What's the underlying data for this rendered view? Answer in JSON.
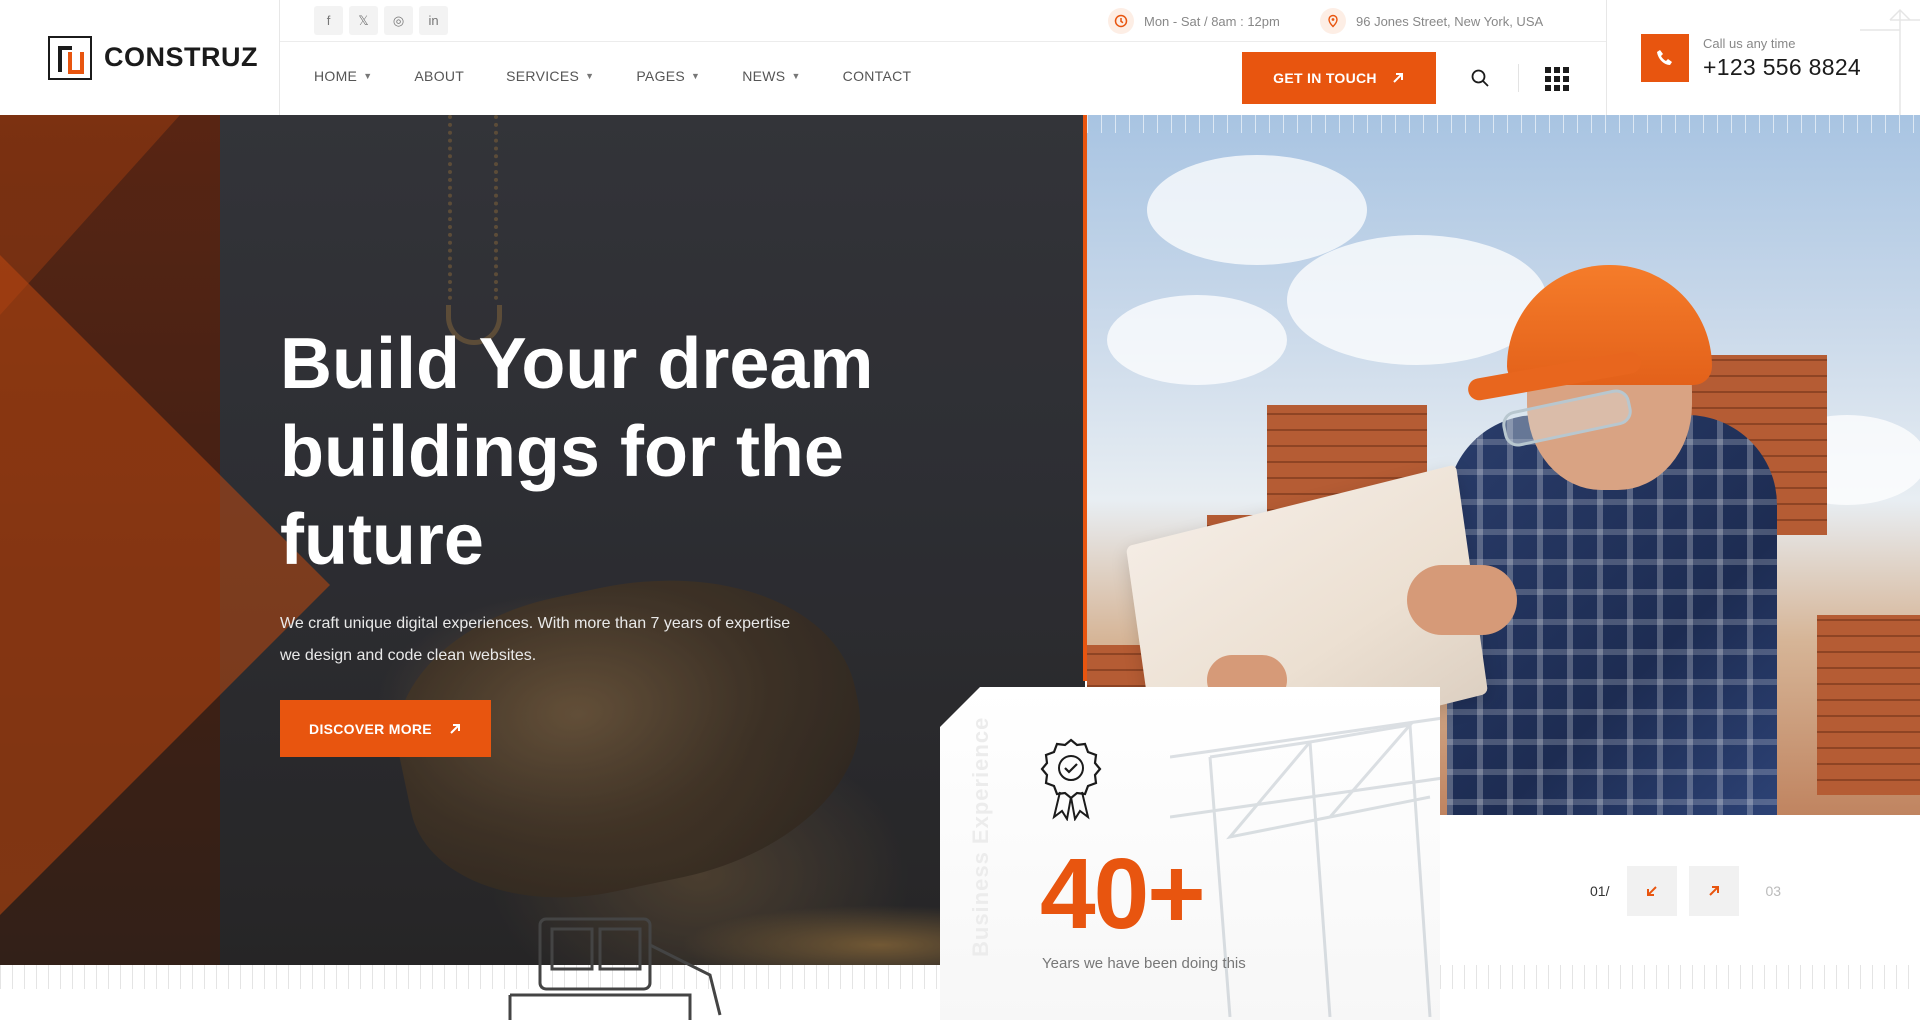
{
  "brand": {
    "name": "CONSTRUZ"
  },
  "topbar": {
    "socials": [
      {
        "icon": "facebook-icon",
        "glyph": "f"
      },
      {
        "icon": "x-twitter-icon",
        "glyph": "𝕏"
      },
      {
        "icon": "instagram-icon",
        "glyph": "◎"
      },
      {
        "icon": "linkedin-icon",
        "glyph": "in"
      }
    ],
    "hours": "Mon - Sat / 8am : 12pm",
    "address": "96 Jones Street, New York, USA"
  },
  "nav": {
    "items": [
      {
        "label": "HOME",
        "has_dropdown": true
      },
      {
        "label": "ABOUT",
        "has_dropdown": false
      },
      {
        "label": "SERVICES",
        "has_dropdown": true
      },
      {
        "label": "PAGES",
        "has_dropdown": true
      },
      {
        "label": "NEWS",
        "has_dropdown": true
      },
      {
        "label": "CONTACT",
        "has_dropdown": false
      }
    ],
    "cta_label": "GET IN TOUCH"
  },
  "call": {
    "label": "Call us any time",
    "number": "+123 556 8824"
  },
  "hero": {
    "title": "Build Your dream\nbuildings for the\nfuture",
    "description": "We craft unique digital experiences. With more than 7 years of expertise we design and code clean websites.",
    "button_label": "DISCOVER MORE"
  },
  "stats": {
    "vertical_label": "Business Experience",
    "number": "40+",
    "caption": "Years we have been doing this"
  },
  "slider": {
    "current": "01",
    "separator": "/",
    "total": "03"
  },
  "colors": {
    "accent": "#e8550f",
    "dark": "#1b1b1b",
    "muted": "#888888"
  }
}
